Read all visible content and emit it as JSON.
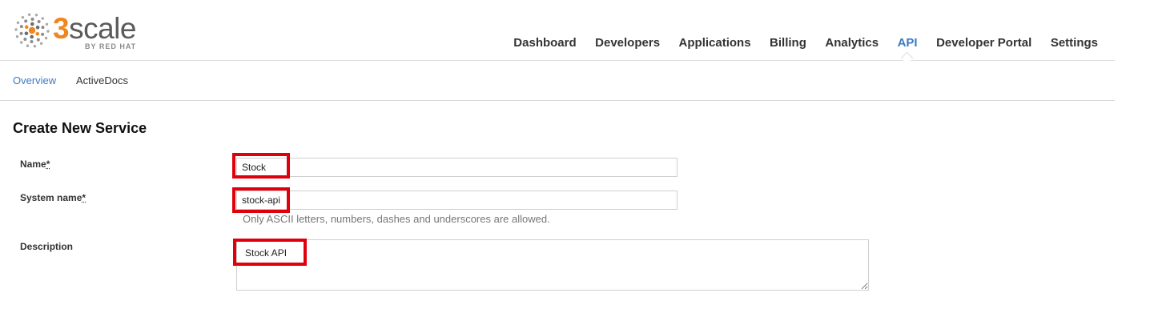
{
  "brand": {
    "logo_number": "3",
    "logo_word": "scale",
    "logo_sub": "BY RED HAT",
    "accent_color": "#f0861e"
  },
  "nav": {
    "items": [
      "Dashboard",
      "Developers",
      "Applications",
      "Billing",
      "Analytics",
      "API",
      "Developer Portal",
      "Settings"
    ],
    "active": "API"
  },
  "subnav": {
    "items": [
      "Overview",
      "ActiveDocs"
    ],
    "active": "Overview"
  },
  "page": {
    "title": "Create New Service"
  },
  "form": {
    "name": {
      "label": "Name",
      "required_mark": "*",
      "value": "Stock"
    },
    "system_name": {
      "label": "System name",
      "required_mark": "*",
      "value": "stock-api",
      "hint": "Only ASCII letters, numbers, dashes and underscores are allowed."
    },
    "description": {
      "label": "Description",
      "value": "Stock API"
    }
  },
  "colors": {
    "link_active": "#3b7ac4",
    "highlight": "#e0000c"
  }
}
